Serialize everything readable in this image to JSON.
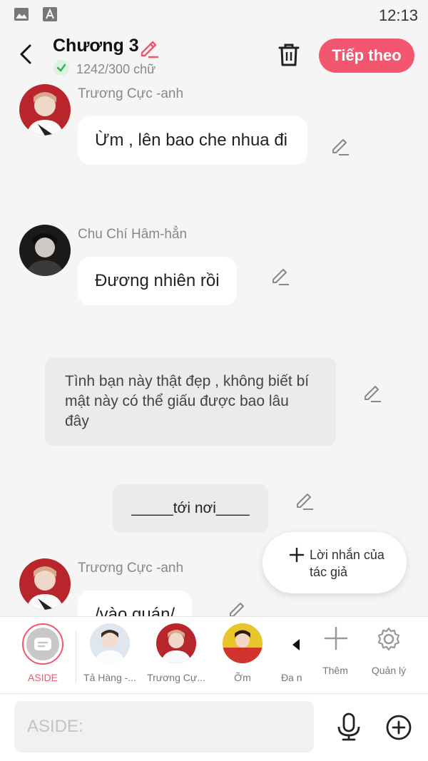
{
  "status": {
    "time": "12:13"
  },
  "header": {
    "title": "Chương 3",
    "word_count": "1242/300 chữ",
    "next_label": "Tiếp theo"
  },
  "messages": [
    {
      "sender": "Trương Cực -anh",
      "text": "Ừm , lên bao che nhua đi"
    },
    {
      "sender": "Chu Chí Hâm-hẳn",
      "text": "Đương nhiên rồi"
    },
    {
      "narration": "Tình bạn này thật đẹp , không biết bí mật này có thể giấu được bao lâu đây"
    },
    {
      "scene": "_____tới nơi____"
    },
    {
      "sender": "Trương Cực -anh",
      "text": "/vào quán/"
    }
  ],
  "fab": {
    "label": "Lời nhắn của tác giả"
  },
  "characters": [
    {
      "label": "ASIDE",
      "active": true
    },
    {
      "label": "Tả Hàng -..."
    },
    {
      "label": "Trương Cự..."
    },
    {
      "label": "Ỡm"
    },
    {
      "label": "Đa n"
    }
  ],
  "toolbar": {
    "add_label": "Thêm",
    "manage_label": "Quản lý"
  },
  "input": {
    "placeholder": "ASIDE:"
  },
  "colors": {
    "accent": "#f3566f",
    "background": "#f5f5f5",
    "bubble": "#ffffff",
    "narration": "#ebebeb"
  }
}
